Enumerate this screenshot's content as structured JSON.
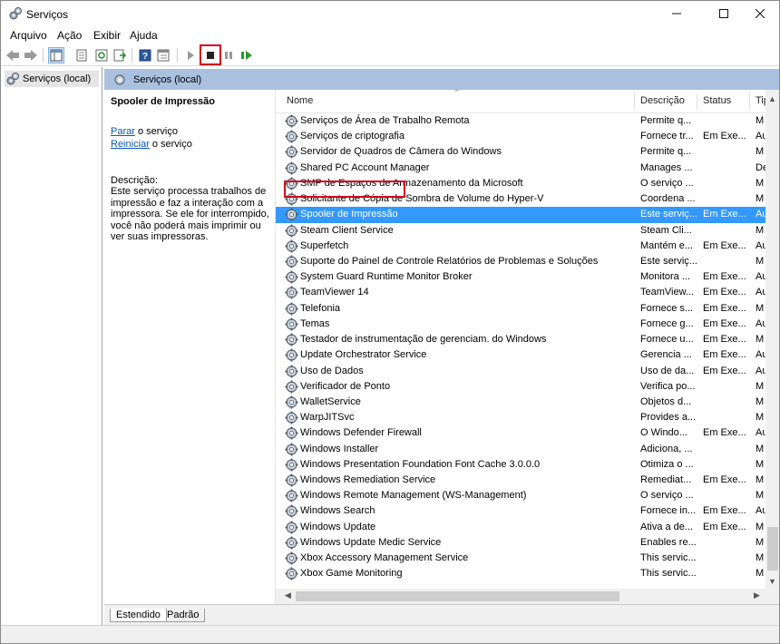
{
  "window": {
    "title": "Serviços"
  },
  "menu": [
    "Arquivo",
    "Ação",
    "Exibir",
    "Ajuda"
  ],
  "tree": {
    "root": "Serviços (local)"
  },
  "header": {
    "title": "Serviços (local)"
  },
  "description": {
    "service_name": "Spooler de Impressão",
    "stop_link": "Parar",
    "stop_suffix": " o serviço",
    "restart_link": "Reiniciar",
    "restart_suffix": " o serviço",
    "label": "Descrição:",
    "text": "Este serviço processa trabalhos de impressão e faz a interação com a impressora. Se ele for interrompido, você não poderá mais imprimir ou ver suas impressoras."
  },
  "columns": {
    "name": "Nome",
    "description": "Descrição",
    "status": "Status",
    "type": "Tip"
  },
  "rows": [
    {
      "name": "Serviços de Área de Trabalho Remota",
      "desc": "Permite q...",
      "status": "",
      "type": "M"
    },
    {
      "name": "Serviços de criptografia",
      "desc": "Fornece tr...",
      "status": "Em Exe...",
      "type": "Au"
    },
    {
      "name": "Servidor de Quadros de Câmera do Windows",
      "desc": "Permite q...",
      "status": "",
      "type": "M"
    },
    {
      "name": "Shared PC Account Manager",
      "desc": "Manages ...",
      "status": "",
      "type": "De"
    },
    {
      "name": "SMP de Espaços de Armazenamento da Microsoft",
      "desc": "O serviço ...",
      "status": "",
      "type": "M"
    },
    {
      "name": "Solicitante de Cópia de Sombra de Volume do Hyper-V",
      "desc": "Coordena ...",
      "status": "",
      "type": "M"
    },
    {
      "name": "Spooler de Impressão",
      "desc": "Este serviç...",
      "status": "Em Exe...",
      "type": "Au",
      "selected": true
    },
    {
      "name": "Steam Client Service",
      "desc": "Steam Cli...",
      "status": "",
      "type": "M"
    },
    {
      "name": "Superfetch",
      "desc": "Mantém e...",
      "status": "Em Exe...",
      "type": "Au"
    },
    {
      "name": "Suporte do Painel de Controle Relatórios de Problemas e Soluções",
      "desc": "Este serviç...",
      "status": "",
      "type": "M"
    },
    {
      "name": "System Guard Runtime Monitor Broker",
      "desc": "Monitora ...",
      "status": "Em Exe...",
      "type": "Au"
    },
    {
      "name": "TeamViewer 14",
      "desc": "TeamView...",
      "status": "Em Exe...",
      "type": "Au"
    },
    {
      "name": "Telefonia",
      "desc": "Fornece s...",
      "status": "Em Exe...",
      "type": "M"
    },
    {
      "name": "Temas",
      "desc": "Fornece g...",
      "status": "Em Exe...",
      "type": "Au"
    },
    {
      "name": "Testador de instrumentação de gerenciam. do Windows",
      "desc": "Fornece u...",
      "status": "Em Exe...",
      "type": "M"
    },
    {
      "name": "Update Orchestrator Service",
      "desc": "Gerencia ...",
      "status": "Em Exe...",
      "type": "Au"
    },
    {
      "name": "Uso de Dados",
      "desc": "Uso de da...",
      "status": "Em Exe...",
      "type": "Au"
    },
    {
      "name": "Verificador de Ponto",
      "desc": "Verifica po...",
      "status": "",
      "type": "M"
    },
    {
      "name": "WalletService",
      "desc": "Objetos d...",
      "status": "",
      "type": "M"
    },
    {
      "name": "WarpJITSvc",
      "desc": "Provides a...",
      "status": "",
      "type": "M"
    },
    {
      "name": "Windows Defender Firewall",
      "desc": "O Windo...",
      "status": "Em Exe...",
      "type": "Au"
    },
    {
      "name": "Windows Installer",
      "desc": "Adiciona, ...",
      "status": "",
      "type": "M"
    },
    {
      "name": "Windows Presentation Foundation Font Cache 3.0.0.0",
      "desc": "Otimiza o ...",
      "status": "",
      "type": "M"
    },
    {
      "name": "Windows Remediation Service",
      "desc": "Remediat...",
      "status": "Em Exe...",
      "type": "M"
    },
    {
      "name": "Windows Remote Management (WS-Management)",
      "desc": "O serviço ...",
      "status": "",
      "type": "M"
    },
    {
      "name": "Windows Search",
      "desc": "Fornece in...",
      "status": "Em Exe...",
      "type": "Au"
    },
    {
      "name": "Windows Update",
      "desc": "Ativa a de...",
      "status": "Em Exe...",
      "type": "M"
    },
    {
      "name": "Windows Update Medic Service",
      "desc": "Enables re...",
      "status": "",
      "type": "M"
    },
    {
      "name": "Xbox Accessory Management Service",
      "desc": "This servic...",
      "status": "",
      "type": "M"
    },
    {
      "name": "Xbox Game Monitoring",
      "desc": "This servic...",
      "status": "",
      "type": "M"
    }
  ],
  "tabs": [
    "Estendido",
    "Padrão"
  ],
  "colors": {
    "selected": "#3399ff",
    "header_band": "#a9c1de",
    "highlight_box": "#d0021b",
    "link": "#0b57b5"
  },
  "icons": {
    "app": "services-gear-icon",
    "back": "back-arrow-icon",
    "forward": "forward-arrow-icon",
    "start": "play-icon",
    "stop": "stop-icon",
    "pause": "pause-icon",
    "resume": "resume-icon",
    "service": "gear-icon"
  }
}
